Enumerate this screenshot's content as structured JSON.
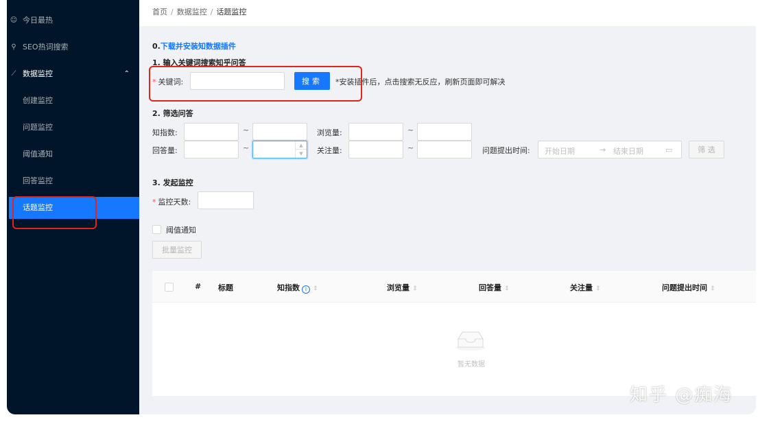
{
  "sidebar": {
    "items": [
      {
        "label": "今日最热",
        "icon": "smile-icon"
      },
      {
        "label": "SEO热词搜索",
        "icon": "search-icon"
      },
      {
        "label": "数据监控",
        "icon": "line-chart-icon"
      },
      {
        "label": "创建监控"
      },
      {
        "label": "问题监控"
      },
      {
        "label": "阈值通知"
      },
      {
        "label": "回答监控"
      },
      {
        "label": "话题监控"
      }
    ]
  },
  "breadcrumb": {
    "home": "首页",
    "section": "数据监控",
    "current": "话题监控",
    "sep": "/"
  },
  "step0": {
    "prefix": "0.",
    "link": "下载并安装知数据插件"
  },
  "step1": {
    "title": "1. 输入关键词搜索知乎问答",
    "keyword_label": "关键词",
    "search_button": "搜索",
    "hint": "*安装插件后，点击搜索无反应，刷新页面即可解决"
  },
  "step2": {
    "title": "2. 筛选问答",
    "zhi_label": "知指数",
    "view_label": "浏览量",
    "answer_label": "回答量",
    "follow_label": "关注量",
    "time_label": "问题提出时间",
    "start_placeholder": "开始日期",
    "end_placeholder": "结束日期",
    "tilde": "~",
    "filter_button": "筛 选"
  },
  "step3": {
    "title": "3. 发起监控",
    "days_label": "监控天数",
    "threshold_label": "阈值通知",
    "batch_button": "批量监控"
  },
  "table": {
    "columns": [
      "#",
      "标题",
      "知指数",
      "浏览量",
      "回答量",
      "关注量",
      "问题提出时间"
    ],
    "empty_text": "暂无数据"
  },
  "watermark": "知乎 @痴海",
  "colors": {
    "sidebar": "#001529",
    "primary": "#1677ff",
    "annotation": "#e0251b"
  }
}
